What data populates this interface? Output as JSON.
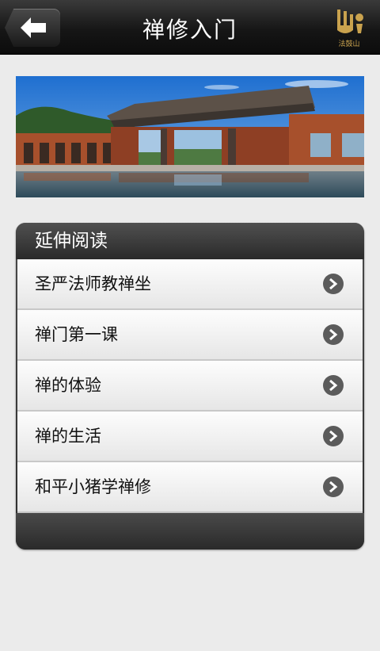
{
  "header": {
    "title": "禅修入门",
    "back_icon": "back-arrow-icon",
    "logo_text": "法鼓山"
  },
  "banner": {
    "image": "building-by-reflecting-pool"
  },
  "reading_panel": {
    "heading": "延伸阅读",
    "items": [
      {
        "label": "圣严法师教禅坐",
        "icon": "chevron-right-icon"
      },
      {
        "label": "禅门第一课",
        "icon": "chevron-right-icon"
      },
      {
        "label": "禅的体验",
        "icon": "chevron-right-icon"
      },
      {
        "label": "禅的生活",
        "icon": "chevron-right-icon"
      },
      {
        "label": "和平小猪学禅修",
        "icon": "chevron-right-icon"
      }
    ]
  },
  "colors": {
    "header_bg": "#161616",
    "logo_gold": "#c9a24e",
    "page_bg": "#ebebeb"
  }
}
